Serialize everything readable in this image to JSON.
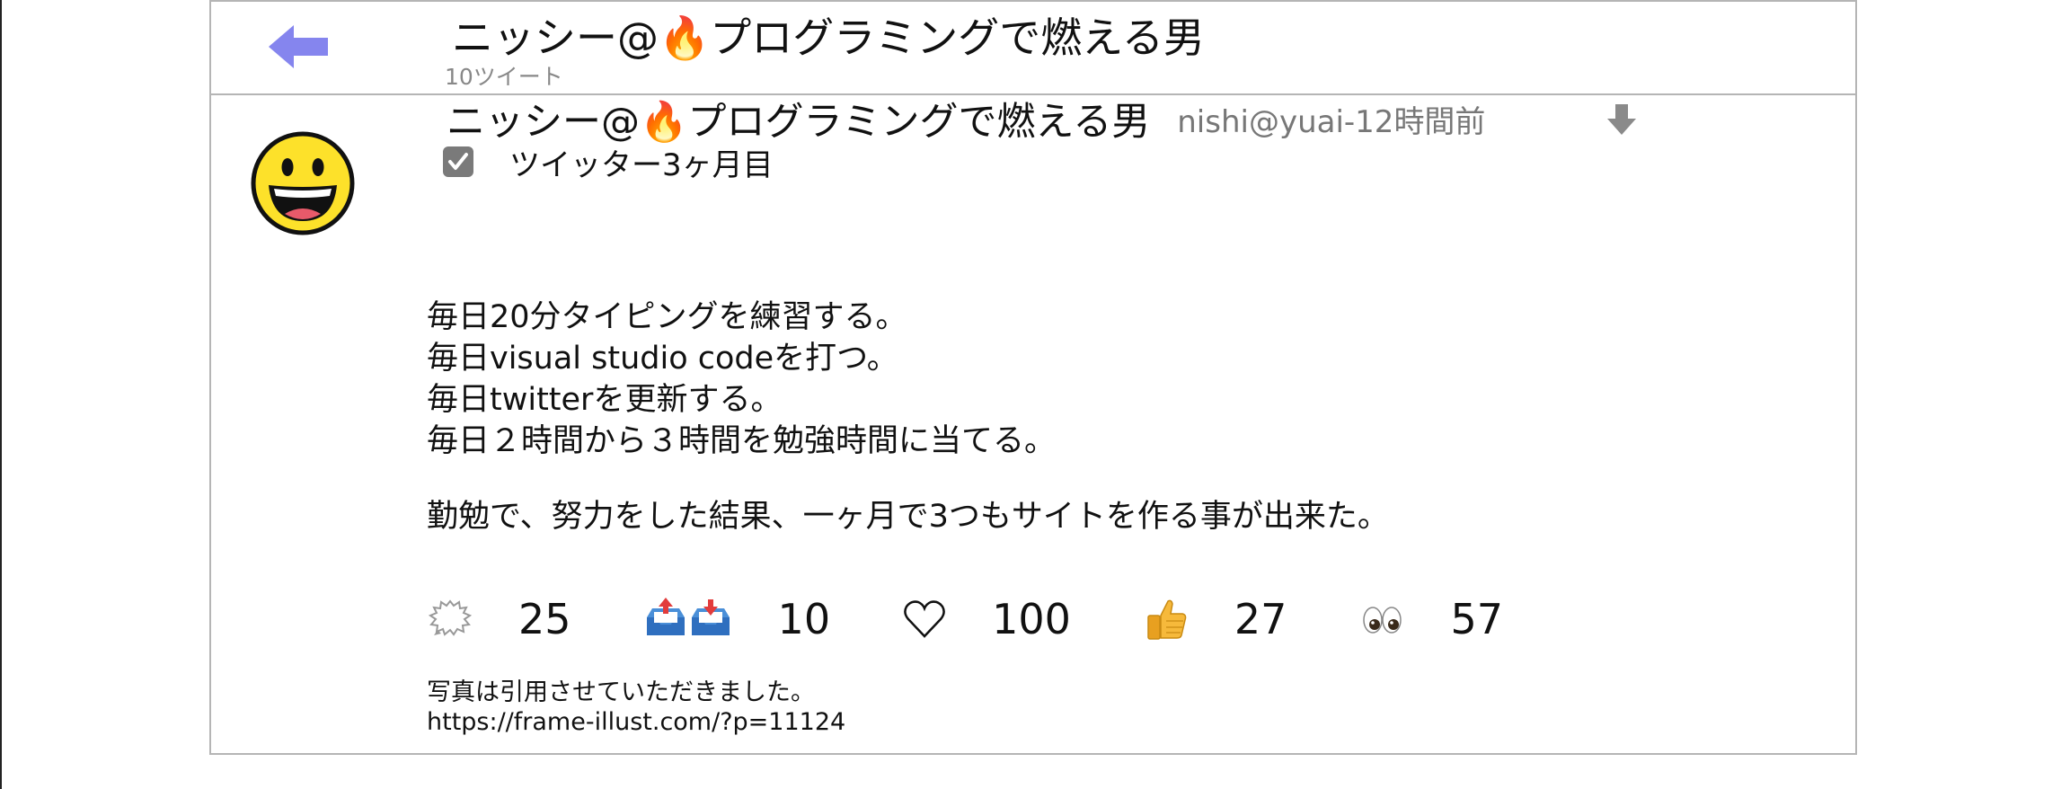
{
  "header": {
    "title": "ニッシー@🔥プログラミングで燃える男",
    "tweet_count": "10ツイート",
    "back_icon": "left-arrow-icon"
  },
  "tweet": {
    "avatar_icon": "smiley-face-icon",
    "display_name": "ニッシー@🔥プログラミングで燃える男",
    "handle_time": "nishi@yuai-12時間前",
    "download_icon": "down-arrow-icon",
    "verified_checkbox": true,
    "meta_label": "ツイッター3ヶ月目",
    "body_lines": [
      "毎日20分タイピングを練習する。",
      "毎日visual studio codeを打つ。",
      "毎日twitterを更新する。",
      "毎日２時間から３時間を勉強時間に当てる。"
    ],
    "body_paragraph_2": "勤勉で、努力をした結果、一ヶ月で3つもサイトを作る事が出来た。",
    "actions": [
      {
        "icon": "speech-bubble-icon",
        "count": "25"
      },
      {
        "icon": "retweet-inbox-icon",
        "count": "10"
      },
      {
        "icon": "heart-icon",
        "count": "100"
      },
      {
        "icon": "thumbs-up-icon",
        "count": "27"
      },
      {
        "icon": "eyes-icon",
        "count": "57"
      }
    ],
    "credit_line_1": "写真は引用させていただきました。",
    "credit_line_2": "https://frame-illust.com/?p=11124"
  },
  "colors": {
    "back_arrow": "#8585ee",
    "border": "#b5b5b5",
    "muted_text": "#888888"
  }
}
